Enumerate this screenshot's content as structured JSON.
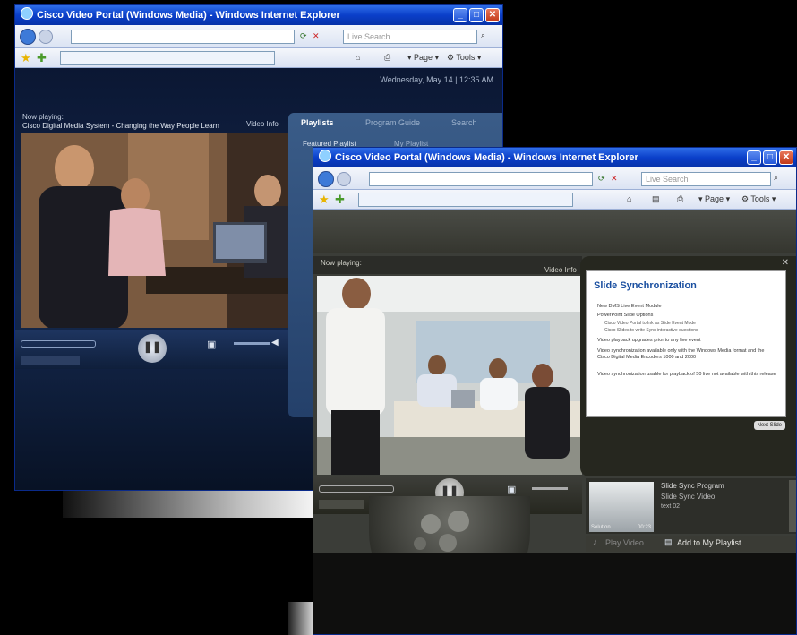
{
  "back_window": {
    "title": "Cisco Video Portal (Windows Media) - Windows Internet Explorer",
    "search_placeholder": "Live Search",
    "cmd_page": "Page",
    "cmd_tools": "Tools",
    "date_text": "Wednesday, May 14 | 12:35 AM",
    "now_playing_label": "Now playing:",
    "now_playing_title": "Cisco Digital Media System - Changing the Way People Learn",
    "video_info": "Video Info",
    "tabs": [
      "Playlists",
      "Program Guide",
      "Search"
    ],
    "featured_label": "Featured Playlist",
    "my_playlist": "My Playlist"
  },
  "front_window": {
    "title": "Cisco Video Portal (Windows Media) - Windows Internet Explorer",
    "search_placeholder": "Live Search",
    "cmd_page": "Page",
    "cmd_tools": "Tools",
    "now_playing_label": "Now playing:",
    "video_info": "Video Info",
    "slide_panel": {
      "title": "Slide Synchronization",
      "bullets": [
        "New DMS Live Event Module",
        "PowerPoint Slide Options",
        "Cisco Video Portal to Ink as Slide Event Mode",
        "Cisco Slides to write Sync interactive questions",
        "Video playback upgrades prior to any live event",
        "Video synchronization available only with the Windows Media format and the Cisco Digital Media Encoders 1000 and 2000",
        "Video synchronization usable for playback of 50 live not available with this release"
      ],
      "next_button": "Next Slide"
    },
    "related": {
      "title": "Slide Sync Program",
      "subtitle": "Slide Sync Video",
      "duration": "text 02",
      "thumb_label": "Solution",
      "thumb_time": "00:23"
    },
    "play_video": "Play Video",
    "add_playlist": "Add to My Playlist"
  }
}
